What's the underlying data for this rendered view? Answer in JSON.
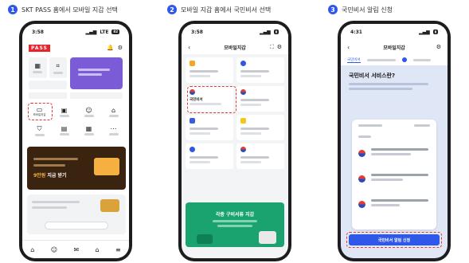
{
  "steps": [
    {
      "number": "1",
      "label": "SKT PASS 홈에서 모바일 지갑 선택"
    },
    {
      "number": "2",
      "label": "모바일 지갑 홈에서 국민비서 선택"
    },
    {
      "number": "3",
      "label": "국민비서 알림 신청"
    }
  ],
  "phone1": {
    "time": "3:58",
    "network": "LTE",
    "battery": "82",
    "logo": "PASS",
    "promo_highlight": "9만원",
    "promo_headline": "지금 받기",
    "menu": {
      "wallet": "모바일지갑"
    },
    "bottom_button": ""
  },
  "phone2": {
    "time": "3:58",
    "title": "모바일지갑",
    "selected_card": {
      "title": "국민비서"
    },
    "banner": {
      "title": "각종 구비서류 지갑"
    }
  },
  "phone3": {
    "time": "4:31",
    "title": "모바일지갑",
    "tabs": [
      "국민비서"
    ],
    "heading": "국민비서 서비스란?",
    "cta": "국민비서 알림 신청"
  },
  "colors": {
    "accent": "#2f57e8",
    "dash": "#e53935",
    "pass_purple": "#7b5cd6",
    "promo_dark": "#3a2410",
    "gold": "#f5b041",
    "banner_green": "#1aa36f"
  }
}
